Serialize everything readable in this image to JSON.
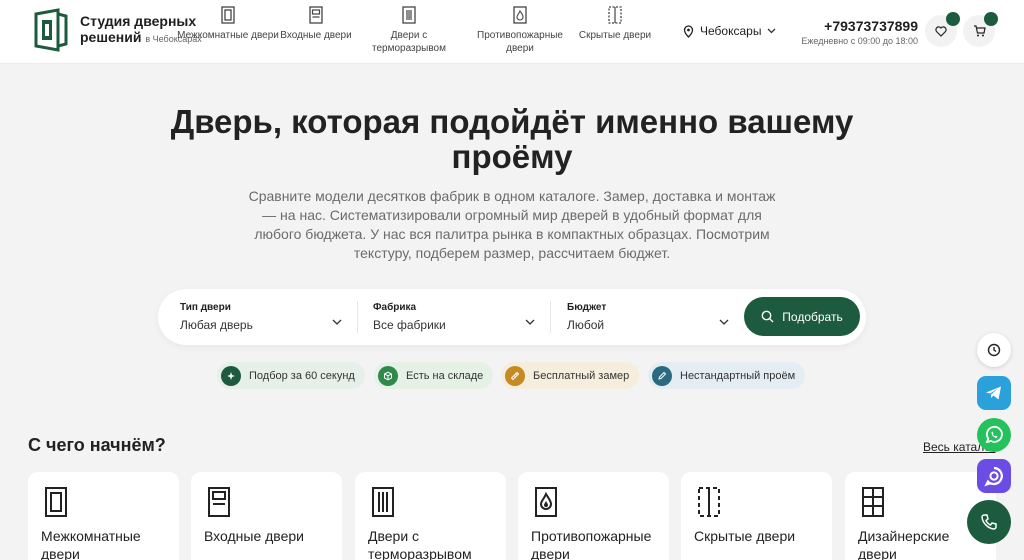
{
  "header": {
    "logo_line1": "Студия дверных",
    "logo_line2": "решений",
    "logo_city": "в Чебоксарах",
    "nav": [
      {
        "label": "Межкомнатные двери",
        "icon": "interior-door-icon"
      },
      {
        "label": "Входные двери",
        "icon": "entrance-door-icon"
      },
      {
        "label": "Двери с терморазрывом",
        "icon": "thermal-door-icon"
      },
      {
        "label": "Противопожарные двери",
        "icon": "fire-door-icon"
      },
      {
        "label": "Скрытые двери",
        "icon": "hidden-door-icon"
      }
    ],
    "city": "Чебоксары",
    "phone": "+79373737899",
    "hours": "Ежедневно с 09:00 до 18:00"
  },
  "hero": {
    "title": "Дверь, которая подойдёт именно вашему проёму",
    "subtitle": "Сравните модели десятков фабрик в одном каталоге. Замер, доставка и монтаж — на нас. Систематизировали огромный мир дверей в удобный формат для любого бюджета. У нас вся палитра рынка в компактных образцах. Посмотрим текстуру, подберем размер, рассчитаем бюджет."
  },
  "search": {
    "fields": [
      {
        "label": "Тип двери",
        "value": "Любая дверь"
      },
      {
        "label": "Фабрика",
        "value": "Все фабрики"
      },
      {
        "label": "Бюджет",
        "value": "Любой"
      }
    ],
    "submit": "Подобрать"
  },
  "chips": [
    {
      "label": "Подбор за 60 секунд",
      "bg": "#e6f0e9",
      "dot": "#1d5b3e"
    },
    {
      "label": "Есть на складе",
      "bg": "#e6f1e6",
      "dot": "#2f8a4a"
    },
    {
      "label": "Бесплатный замер",
      "bg": "#f6eedd",
      "dot": "#c68a23"
    },
    {
      "label": "Нестандартный проём",
      "bg": "#e4eef2",
      "dot": "#2a6a80"
    }
  ],
  "section": {
    "title": "С чего начнём?",
    "catalog_link": "Весь каталог"
  },
  "cards": [
    {
      "label": "Межкомнатные двери"
    },
    {
      "label": "Входные двери"
    },
    {
      "label": "Двери с терморазрывом"
    },
    {
      "label": "Противопожарные двери"
    },
    {
      "label": "Скрытые двери"
    },
    {
      "label": "Дизайнерские двери"
    }
  ],
  "colors": {
    "brand": "#1d5b3e",
    "telegram": "#2aa1da",
    "whatsapp": "#25c15d",
    "max": "#6b4de6"
  }
}
